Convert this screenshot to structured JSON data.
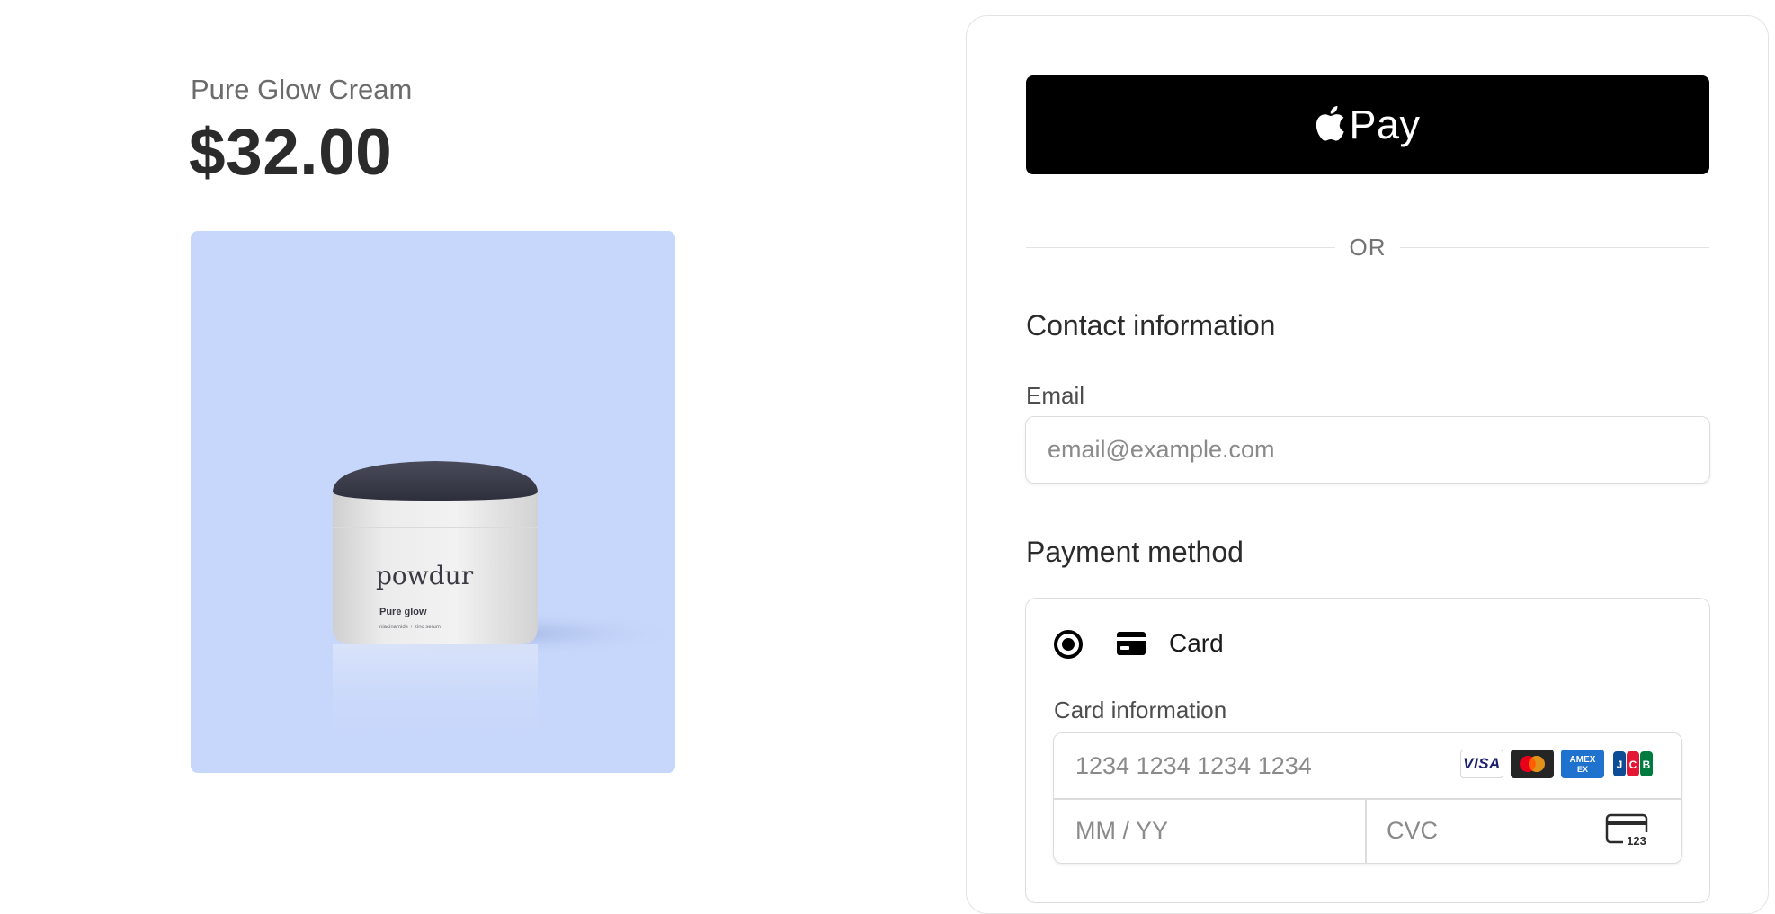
{
  "product": {
    "name": "Pure Glow Cream",
    "price": "$32.00",
    "image": {
      "brand_text": "powdur",
      "product_text": "Pure glow",
      "subtext": "niacinamide + zinc serum",
      "background": "#c7d7fb"
    }
  },
  "checkout": {
    "apple_pay_label": "Pay",
    "apple_icon": "apple-icon",
    "divider_text": "OR",
    "contact": {
      "heading": "Contact information",
      "email_label": "Email",
      "email_placeholder": "email@example.com"
    },
    "payment": {
      "heading": "Payment method",
      "option_label": "Card",
      "option_icon": "credit-card-icon",
      "card_info_label": "Card information",
      "card_number_placeholder": "1234 1234 1234 1234",
      "expiry_placeholder": "MM / YY",
      "cvc_placeholder": "CVC",
      "cvc_icon_text": "123",
      "brands": {
        "visa": "VISA",
        "amex": "AMEX",
        "jcb": "JCB"
      }
    }
  },
  "colors": {
    "apple_pay_bg": "#000000",
    "border": "#dcdcdc",
    "amex_blue": "#1f72cd",
    "mastercard_red": "#eb001b",
    "mastercard_orange": "#f79e1b"
  }
}
